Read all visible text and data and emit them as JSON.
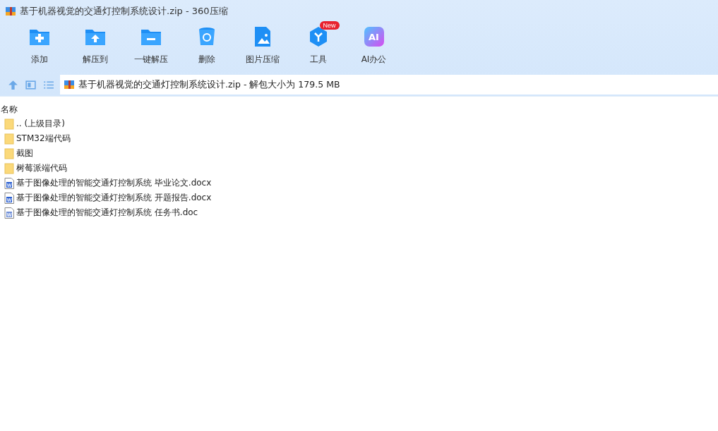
{
  "window": {
    "title": "基于机器视觉的交通灯控制系统设计.zip - 360压缩"
  },
  "toolbar": [
    {
      "kind": "add",
      "label": "添加"
    },
    {
      "kind": "extract-to",
      "label": "解压到"
    },
    {
      "kind": "extract",
      "label": "一键解压"
    },
    {
      "kind": "delete",
      "label": "删除"
    },
    {
      "kind": "image",
      "label": "图片压缩"
    },
    {
      "kind": "tools",
      "label": "工具",
      "badge": "New"
    },
    {
      "kind": "ai",
      "label": "AI办公",
      "icon_text": "AI"
    }
  ],
  "address": {
    "path": "基于机器视觉的交通灯控制系统设计.zip - 解包大小为 179.5 MB"
  },
  "table": {
    "columns": [
      "名称"
    ],
    "rows": [
      {
        "kind": "folder",
        "name": ".. (上级目录)"
      },
      {
        "kind": "folder",
        "name": "STM32端代码"
      },
      {
        "kind": "folder",
        "name": "截图"
      },
      {
        "kind": "folder",
        "name": "树莓派端代码"
      },
      {
        "kind": "word",
        "icon_text": "W",
        "name": "基于图像处理的智能交通灯控制系统 毕业论文.docx"
      },
      {
        "kind": "word",
        "icon_text": "W",
        "name": "基于图像处理的智能交通灯控制系统 开题报告.docx"
      },
      {
        "kind": "word-old",
        "icon_text": "W",
        "name": "基于图像处理的智能交通灯控制系统 任务书.doc"
      }
    ]
  }
}
